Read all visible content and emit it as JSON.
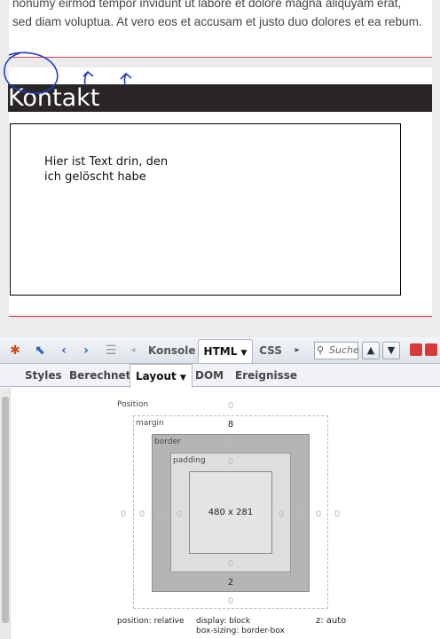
{
  "page": {
    "paragraph": "nonumy eirmod tempor invidunt ut labore et dolore magna aliquyam erat, sed diam voluptua. At vero eos et accusam et justo duo dolores et ea rebum.",
    "heading": "Kontakt",
    "textbox_text": "Hier ist Text drin, den ich gelöscht habe"
  },
  "toolbar": {
    "tabs": [
      "Konsole",
      "HTML",
      "CSS"
    ],
    "active_tab": "HTML",
    "search_placeholder": "Suche"
  },
  "subtabs": {
    "items": [
      "Styles",
      "Berechnet",
      "Layout",
      "DOM",
      "Ereignisse"
    ],
    "active": "Layout"
  },
  "layout": {
    "position_label": "Position",
    "margin_label": "margin",
    "border_label": "border",
    "padding_label": "padding",
    "position_values": {
      "top": "0",
      "left": "0",
      "right": "0",
      "bottom": "0"
    },
    "margin_values": {
      "top": "8",
      "left": "0",
      "right": "0",
      "bottom": "0"
    },
    "border_values": {
      "top": "0",
      "left": "0",
      "right": "0",
      "bottom": "2"
    },
    "padding_values": {
      "top": "0",
      "left": "0",
      "right": "0",
      "bottom": "0"
    },
    "content_size": "480 x 281",
    "position_text": "position: relative",
    "display_text": "display: block",
    "boxsizing_text": "box-sizing: border-box",
    "z_text": "z: auto"
  },
  "colors": {
    "accent_red": "#e23b4e",
    "heading_bar": "#2a2626",
    "annotation_blue": "#1d3fc9"
  }
}
